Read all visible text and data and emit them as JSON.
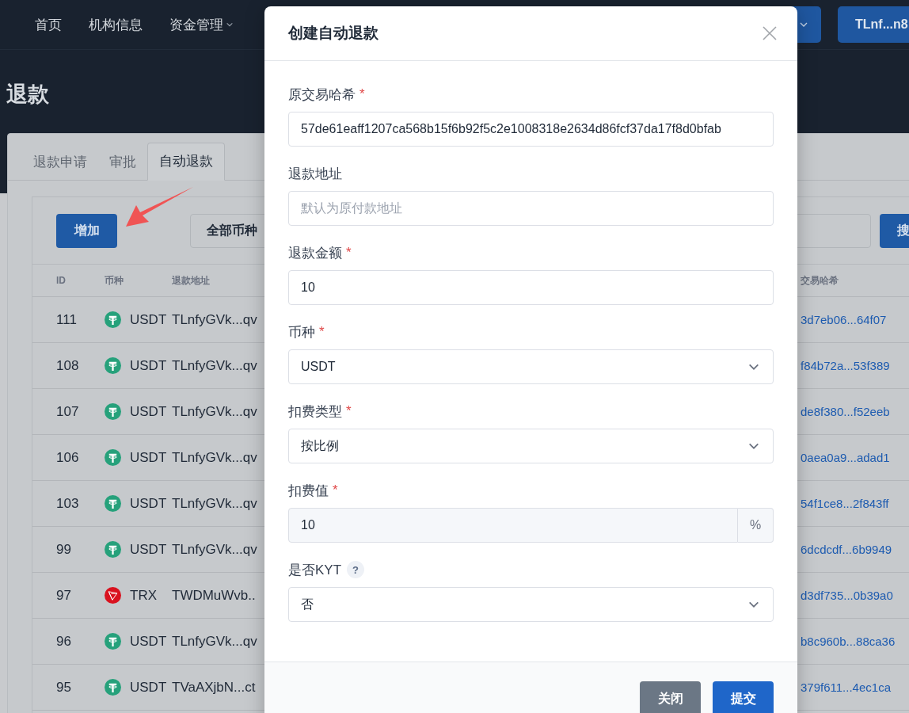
{
  "nav": {
    "items": [
      {
        "label": "首页",
        "dropdown": false
      },
      {
        "label": "机构信息",
        "dropdown": false
      },
      {
        "label": "资金管理",
        "dropdown": true
      }
    ],
    "network_button": {
      "dropdown": true
    },
    "account_button": {
      "label": "TLnf...n8"
    }
  },
  "page_title": "退款",
  "tabs": [
    {
      "label": "退款申请",
      "selected": false
    },
    {
      "label": "审批",
      "selected": false
    },
    {
      "label": "自动退款",
      "selected": true
    }
  ],
  "toolbar": {
    "add_button": "增加",
    "currency_filter": "全部币种",
    "search_button": "搜"
  },
  "table": {
    "columns": [
      "ID",
      "币种",
      "退款地址",
      "交易哈希"
    ],
    "rows": [
      {
        "id": "111",
        "kind": "usdt",
        "coin": "USDT",
        "address": "TLnfyGVk...qv",
        "hash": "3d7eb06...64f07"
      },
      {
        "id": "108",
        "kind": "usdt",
        "coin": "USDT",
        "address": "TLnfyGVk...qv",
        "hash": "f84b72a...53f389"
      },
      {
        "id": "107",
        "kind": "usdt",
        "coin": "USDT",
        "address": "TLnfyGVk...qv",
        "hash": "de8f380...f52eeb"
      },
      {
        "id": "106",
        "kind": "usdt",
        "coin": "USDT",
        "address": "TLnfyGVk...qv",
        "hash": "0aea0a9...adad1"
      },
      {
        "id": "103",
        "kind": "usdt",
        "coin": "USDT",
        "address": "TLnfyGVk...qv",
        "hash": "54f1ce8...2f843ff"
      },
      {
        "id": "99",
        "kind": "usdt",
        "coin": "USDT",
        "address": "TLnfyGVk...qv",
        "hash": "6dcdcdf...6b9949"
      },
      {
        "id": "97",
        "kind": "trx",
        "coin": "TRX",
        "address": "TWDMuWvb..",
        "hash": "d3df735...0b39a0"
      },
      {
        "id": "96",
        "kind": "usdt",
        "coin": "USDT",
        "address": "TLnfyGVk...qv",
        "hash": "b8c960b...88ca36"
      },
      {
        "id": "95",
        "kind": "usdt",
        "coin": "USDT",
        "address": "TVaAXjbN...ct",
        "hash": "379f611...4ec1ca"
      }
    ]
  },
  "dialog": {
    "title": "创建自动退款",
    "fields": [
      {
        "kind": "text",
        "label": "原交易哈希",
        "required_mark": "*",
        "value": "57de61eaff1207ca568b15f6b92f5c2e1008318e2634d86fcf37da17f8d0bfab"
      },
      {
        "kind": "text",
        "label": "退款地址",
        "placeholder": "默认为原付款地址"
      },
      {
        "kind": "text",
        "label": "退款金额",
        "required_mark": "*",
        "value": "10"
      },
      {
        "kind": "select",
        "label": "币种",
        "required_mark": "*",
        "value": "USDT"
      },
      {
        "kind": "select",
        "label": "扣费类型",
        "required_mark": "*",
        "value": "按比例"
      },
      {
        "kind": "addon",
        "label": "扣费值",
        "required_mark": "*",
        "value": "10",
        "suffix": "%",
        "disabled": true
      },
      {
        "kind": "select",
        "label": "是否KYT",
        "help": "?",
        "value": "否"
      }
    ],
    "buttons": [
      {
        "label": "关闭",
        "kind": "secondary"
      },
      {
        "label": "提交",
        "kind": "primary"
      }
    ]
  }
}
